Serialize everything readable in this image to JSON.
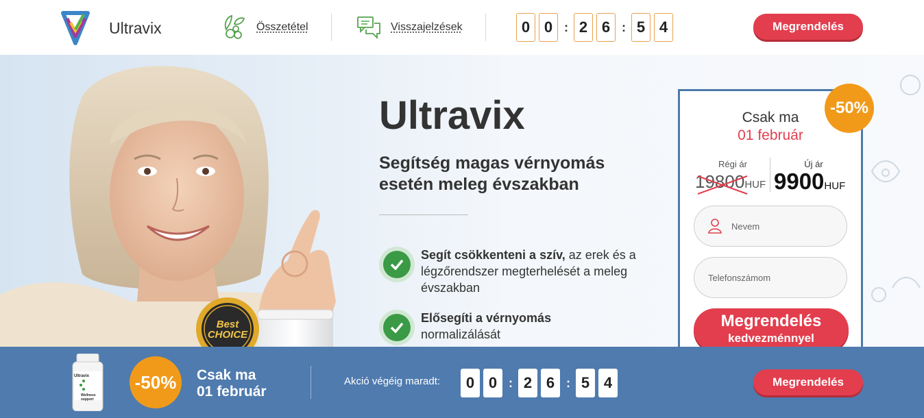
{
  "header": {
    "brand": "Ultravix",
    "nav": [
      {
        "label": "Összetétel",
        "icon": "herbs-icon"
      },
      {
        "label": "Visszajelzések",
        "icon": "chat-bubbles-icon"
      }
    ],
    "timer": [
      "0",
      "0",
      "2",
      "6",
      "5",
      "4"
    ],
    "order_label": "Megrendelés"
  },
  "hero": {
    "title": "Ultravix",
    "subtitle": "Segítség magas vérnyomás esetén meleg évszakban",
    "benefits": [
      {
        "bold": "Segít csökkenteni a szív,",
        "text": " az erek és a légzőrendszer megterhelését a meleg évszakban"
      },
      {
        "bold": "Elősegíti a vérnyomás",
        "text": "normalizálását"
      }
    ],
    "seal_text": [
      "BEST CHOICE",
      "Best",
      "CHOICE"
    ]
  },
  "offer": {
    "discount": "-50%",
    "only_today": "Csak ma",
    "date": "01 február",
    "old_label": "Régi ár",
    "old_price": "19800",
    "new_label": "Új ár",
    "new_price": "9900",
    "currency": "HUF",
    "name_placeholder": "Nevem",
    "phone_placeholder": "Telefonszámom",
    "cta_line1": "Megrendelés",
    "cta_line2": "kedvezménnyel"
  },
  "bottom": {
    "bottle_label": "Ultravix",
    "bottle_sub": "Wellness support",
    "discount": "-50%",
    "only_today": "Csak ma",
    "date": "01 február",
    "timer_label": "Akció végéig maradt:",
    "timer": [
      "0",
      "0",
      "2",
      "6",
      "5",
      "4"
    ],
    "order_label": "Megrendelés"
  },
  "colors": {
    "accent_red": "#e23e4e",
    "accent_orange": "#f19a1a",
    "bar_blue": "#4f7bae",
    "check_green": "#3a9a45"
  }
}
